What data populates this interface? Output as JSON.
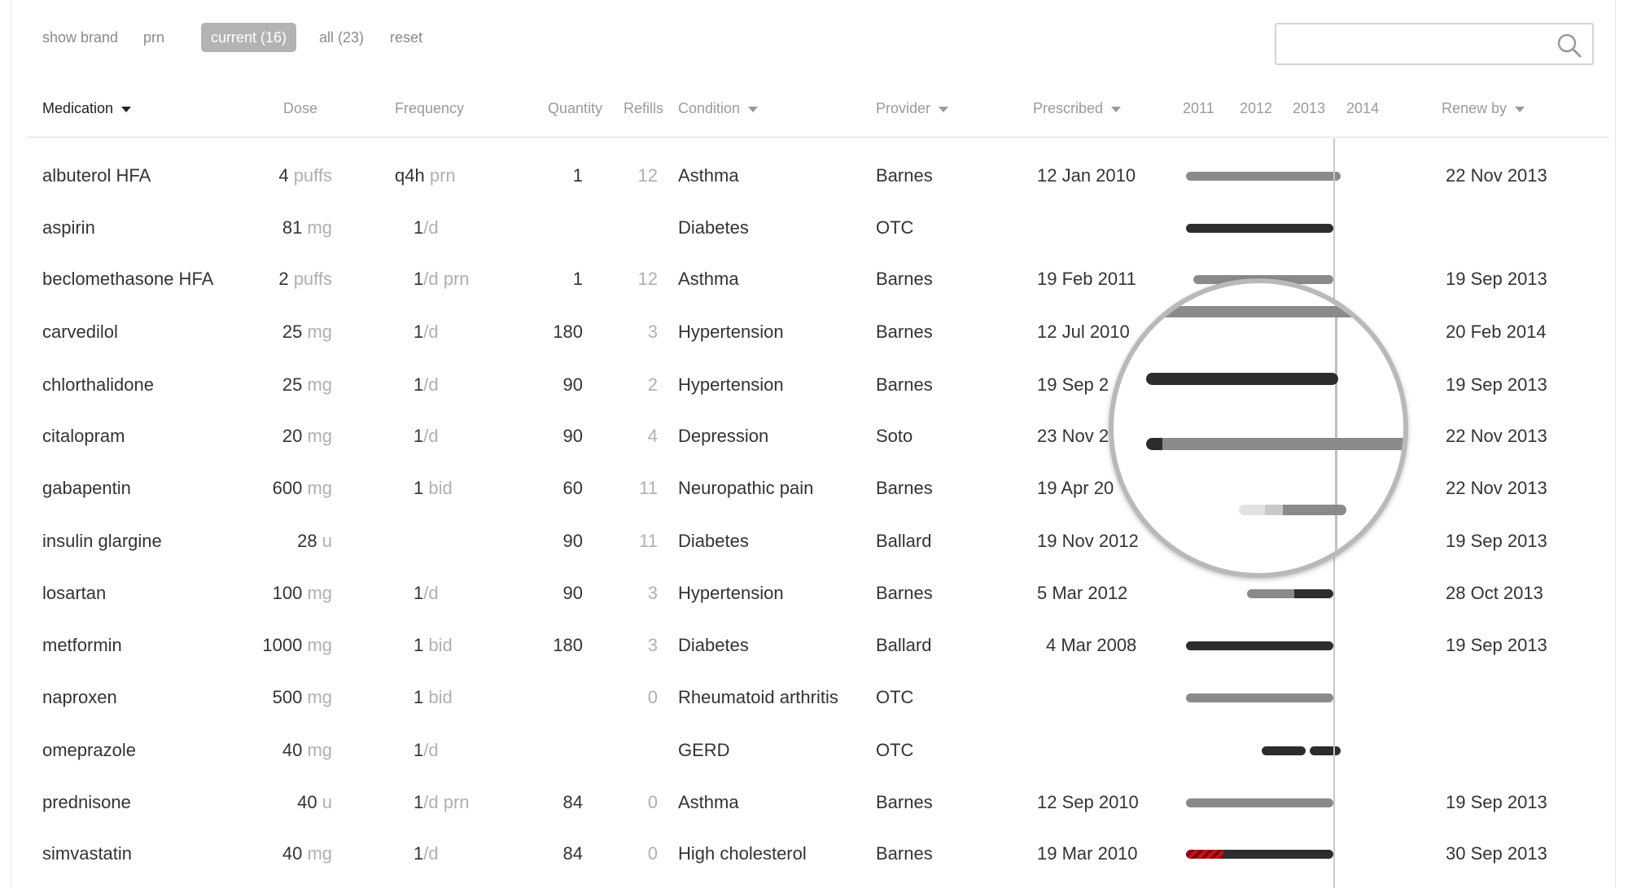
{
  "filters": {
    "show_brand": "show brand",
    "prn": "prn",
    "current": "current (16)",
    "all": "all (23)",
    "reset": "reset"
  },
  "search": {
    "placeholder": "",
    "icon": "search-icon"
  },
  "columns": {
    "medication": "Medication",
    "dose": "Dose",
    "frequency": "Frequency",
    "quantity": "Quantity",
    "refills": "Refills",
    "condition": "Condition",
    "provider": "Provider",
    "prescribed": "Prescribed",
    "renew_by": "Renew by"
  },
  "timeline_years": [
    "2011",
    "2012",
    "2013",
    "2014"
  ],
  "rows": [
    {
      "medication": "albuterol HFA",
      "dose": "4",
      "unit": "puffs",
      "freq": "q4h",
      "freq_muted": "prn",
      "quantity": "1",
      "refills": "12",
      "condition": "Asthma",
      "provider": "Barnes",
      "prescribed": "12  Jan  2010",
      "renew": "22  Nov  2013"
    },
    {
      "medication": "aspirin",
      "dose": "81",
      "unit": "mg",
      "freq": "1",
      "freq_muted": "/d",
      "quantity": "",
      "refills": "",
      "condition": "Diabetes",
      "provider": "OTC",
      "prescribed": "",
      "renew": ""
    },
    {
      "medication": "beclomethasone HFA",
      "dose": "2",
      "unit": "puffs",
      "freq": "1",
      "freq_muted": "/d prn",
      "quantity": "1",
      "refills": "12",
      "condition": "Asthma",
      "provider": "Barnes",
      "prescribed": "19  Feb  2011",
      "renew": "19  Sep  2013"
    },
    {
      "medication": "carvedilol",
      "dose": "25",
      "unit": "mg",
      "freq": "1",
      "freq_muted": "/d",
      "quantity": "180",
      "refills": "3",
      "condition": "Hypertension",
      "provider": "Barnes",
      "prescribed": "12  Jul  2010",
      "renew": "20  Feb  2014"
    },
    {
      "medication": "chlorthalidone",
      "dose": "25",
      "unit": "mg",
      "freq": "1",
      "freq_muted": "/d",
      "quantity": "90",
      "refills": "2",
      "condition": "Hypertension",
      "provider": "Barnes",
      "prescribed": "19  Sep  2",
      "renew": "19  Sep  2013"
    },
    {
      "medication": "citalopram",
      "dose": "20",
      "unit": "mg",
      "freq": "1",
      "freq_muted": "/d",
      "quantity": "90",
      "refills": "4",
      "condition": "Depression",
      "provider": "Soto",
      "prescribed": "23  Nov  2",
      "renew": "22  Nov  2013"
    },
    {
      "medication": "gabapentin",
      "dose": "600",
      "unit": "mg",
      "freq": "1",
      "freq_muted": "bid",
      "quantity": "60",
      "refills": "11",
      "condition": "Neuropathic pain",
      "provider": "Barnes",
      "prescribed": "19  Apr  20",
      "renew": "22  Nov  2013"
    },
    {
      "medication": "insulin glargine",
      "dose": "28",
      "unit": "u",
      "freq": "",
      "freq_muted": "",
      "quantity": "90",
      "refills": "11",
      "condition": "Diabetes",
      "provider": "Ballard",
      "prescribed": "19  Nov  2012",
      "renew": "19  Sep  2013"
    },
    {
      "medication": "losartan",
      "dose": "100",
      "unit": "mg",
      "freq": "1",
      "freq_muted": "/d",
      "quantity": "90",
      "refills": "3",
      "condition": "Hypertension",
      "provider": "Barnes",
      "prescribed": "5  Mar  2012",
      "renew": "28  Oct  2013"
    },
    {
      "medication": "metformin",
      "dose": "1000",
      "unit": "mg",
      "freq": "1",
      "freq_muted": "bid",
      "quantity": "180",
      "refills": "3",
      "condition": "Diabetes",
      "provider": "Ballard",
      "prescribed": "4  Mar  2008",
      "renew": "19  Sep  2013"
    },
    {
      "medication": "naproxen",
      "dose": "500",
      "unit": "mg",
      "freq": "1",
      "freq_muted": "bid",
      "quantity": "",
      "refills": "0",
      "condition": "Rheumatoid arthritis",
      "provider": "OTC",
      "prescribed": "",
      "renew": ""
    },
    {
      "medication": "omeprazole",
      "dose": "40",
      "unit": "mg",
      "freq": "1",
      "freq_muted": "/d",
      "quantity": "",
      "refills": "",
      "condition": "GERD",
      "provider": "OTC",
      "prescribed": "",
      "renew": ""
    },
    {
      "medication": "prednisone",
      "dose": "40",
      "unit": "u",
      "freq": "1",
      "freq_muted": "/d prn",
      "quantity": "84",
      "refills": "0",
      "condition": "Asthma",
      "provider": "Barnes",
      "prescribed": "12  Sep  2010",
      "renew": "19  Sep  2013"
    },
    {
      "medication": "simvastatin",
      "dose": "40",
      "unit": "mg",
      "freq": "1",
      "freq_muted": "/d",
      "quantity": "84",
      "refills": "0",
      "condition": "High cholesterol",
      "provider": "Barnes",
      "prescribed": "19  Mar  2010",
      "renew": "30  Sep  2013"
    }
  ],
  "colors": {
    "bar_gray": "#8a8a8a",
    "bar_dark": "#2d2d2d",
    "bar_red": "#c4131a",
    "muted_text": "#b0b0b0"
  }
}
